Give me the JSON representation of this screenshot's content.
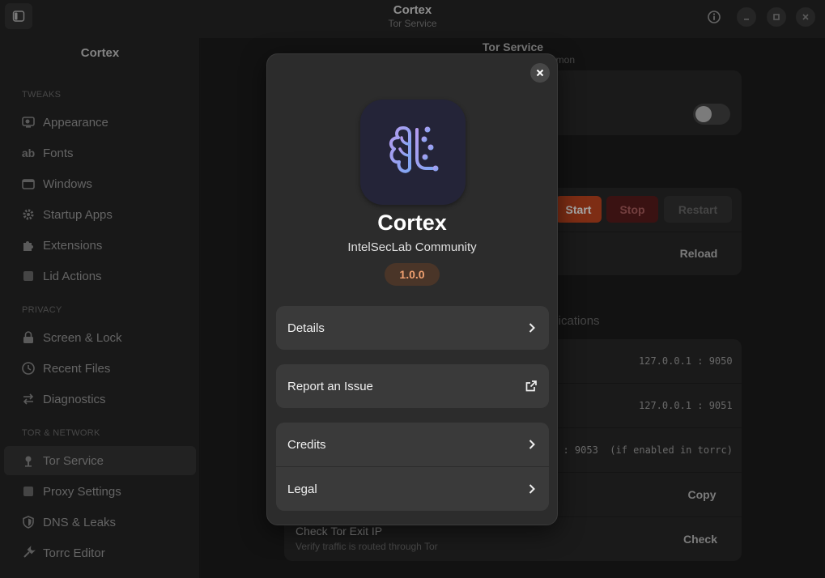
{
  "window": {
    "title": "Cortex",
    "subtitle": "Tor Service"
  },
  "sidebar": {
    "title": "Cortex",
    "sections": {
      "tweaks": "TWEAKS",
      "privacy": "PRIVACY",
      "tor_network": "TOR & NETWORK"
    },
    "items": [
      {
        "label": "Appearance",
        "icon": "appearance-icon"
      },
      {
        "label": "Fonts",
        "icon": "fonts-icon"
      },
      {
        "label": "Windows",
        "icon": "windows-icon"
      },
      {
        "label": "Startup Apps",
        "icon": "gear-icon"
      },
      {
        "label": "Extensions",
        "icon": "puzzle-icon"
      },
      {
        "label": "Lid Actions",
        "icon": "laptop-icon"
      },
      {
        "label": "Screen & Lock",
        "icon": "lock-icon"
      },
      {
        "label": "Recent Files",
        "icon": "clock-icon"
      },
      {
        "label": "Diagnostics",
        "icon": "arrows-icon"
      },
      {
        "label": "Tor Service",
        "icon": "tor-icon",
        "active": true
      },
      {
        "label": "Proxy Settings",
        "icon": "proxy-icon"
      },
      {
        "label": "DNS & Leaks",
        "icon": "shield-icon"
      },
      {
        "label": "Torrc Editor",
        "icon": "wrench-icon"
      }
    ]
  },
  "main": {
    "title": "Tor Service",
    "subtitle_fragment": "emon",
    "service_buttons": {
      "start": "Start",
      "stop": "Stop",
      "restart": "Restart"
    },
    "reload": "Reload",
    "section_fragment": "plications",
    "socks_port": "127.0.0.1 : 9050",
    "control_port": "127.0.0.1 : 9051",
    "dns_port": "l : 9053  (if enabled in torrc)",
    "copy": "Copy",
    "check_title": "Check Tor Exit IP",
    "check_subtitle": "Verify traffic is routed through Tor",
    "check": "Check"
  },
  "about": {
    "app_name": "Cortex",
    "developer": "IntelSecLab Community",
    "version": "1.0.0",
    "rows": {
      "details": "Details",
      "report": "Report an Issue",
      "credits": "Credits",
      "legal": "Legal"
    },
    "colors": {
      "accent": "#e05a2a",
      "version_text": "#f0a070",
      "icon_bg": "#242438"
    }
  }
}
